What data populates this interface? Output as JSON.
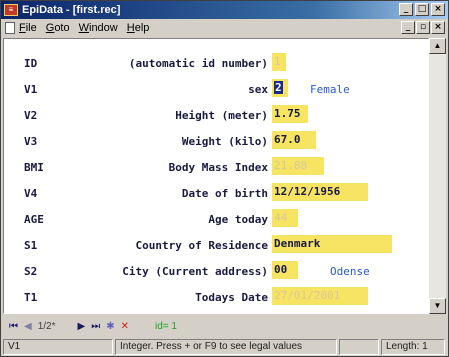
{
  "window": {
    "title": "EpiData - [first.rec]"
  },
  "menu": {
    "items": [
      "File",
      "Goto",
      "Window",
      "Help"
    ]
  },
  "title_buttons": [
    "_",
    "□",
    "×"
  ],
  "mdi_buttons": [
    "_",
    "▫",
    "×"
  ],
  "form": {
    "fields": [
      {
        "name": "ID",
        "label": "(automatic id number)",
        "value": "1",
        "computed": true
      },
      {
        "name": "V1",
        "label": "sex",
        "value": "2",
        "hint": "Female",
        "focused": true
      },
      {
        "name": "V2",
        "label": "Height (meter)",
        "value": "1.75"
      },
      {
        "name": "V3",
        "label": "Weight (kilo)",
        "value": "67.0"
      },
      {
        "name": "BMI",
        "label": "Body Mass Index",
        "value": "21.88",
        "computed": true
      },
      {
        "name": "V4",
        "label": "Date of birth",
        "value": "12/12/1956"
      },
      {
        "name": "AGE",
        "label": "Age today",
        "value": "44",
        "computed": true
      },
      {
        "name": "S1",
        "label": "Country of Residence",
        "value": "Denmark"
      },
      {
        "name": "S2",
        "label": "City (Current address)",
        "value": "00",
        "hint": "Odense"
      },
      {
        "name": "T1",
        "label": "Todays Date",
        "value": "27/01/2001",
        "computed": true
      }
    ]
  },
  "nav": {
    "record_info": "1/2*",
    "first": "⏮",
    "prev": "◀",
    "next": "▶",
    "last": "⏭",
    "new": "✱",
    "delete": "✕",
    "id_text": "id= 1"
  },
  "status": {
    "field": "V1",
    "message": "Integer.  Press + or F9 to see legal values",
    "length": "Length: 1"
  },
  "colors": {
    "field_bg": "#f7e463",
    "hint_text": "#2a5ad0",
    "titlebar": "#0a246a"
  }
}
